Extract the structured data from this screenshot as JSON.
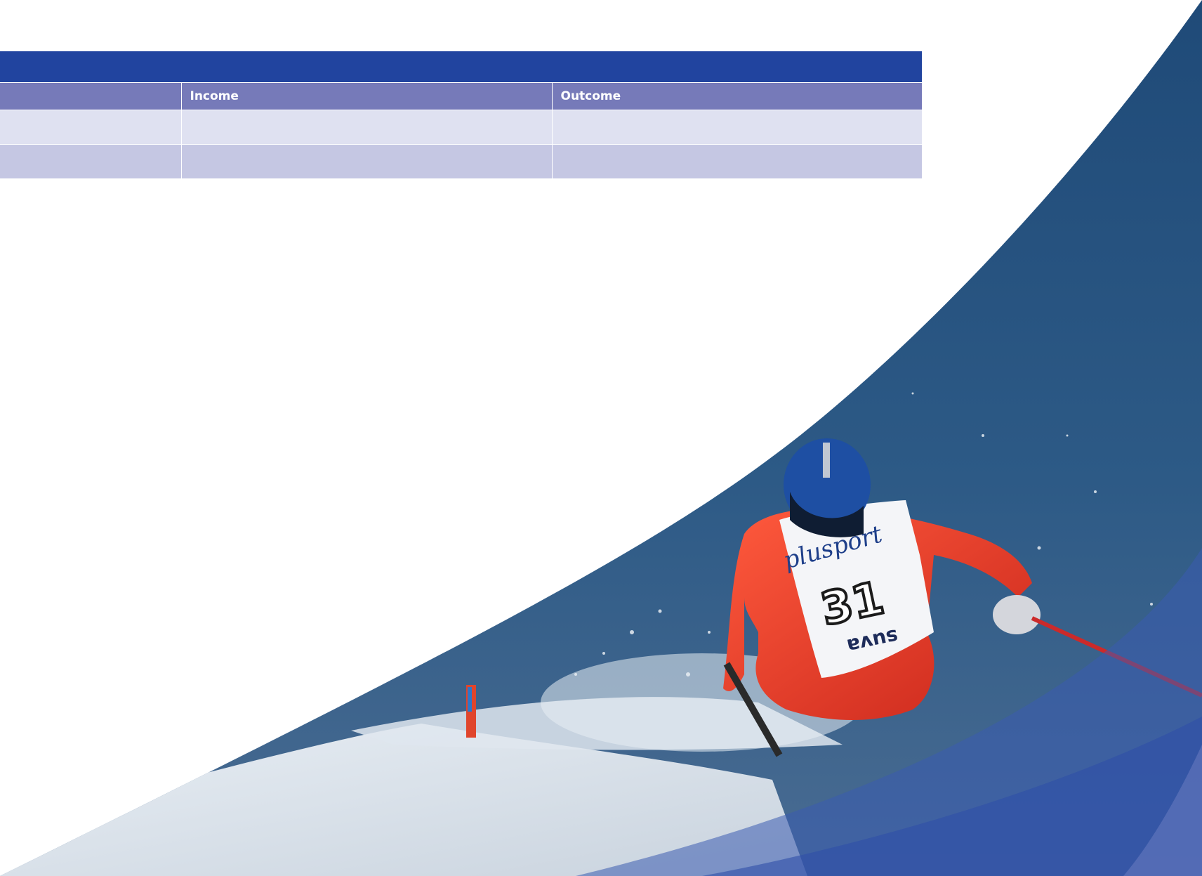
{
  "table": {
    "headers": [
      "",
      "Income",
      "Outcome"
    ],
    "rows": [
      [
        "",
        "",
        ""
      ],
      [
        "",
        "",
        ""
      ]
    ]
  },
  "hero": {
    "bib_text": "plusport",
    "bib_number": "31",
    "bib_sponsor": "suva"
  }
}
